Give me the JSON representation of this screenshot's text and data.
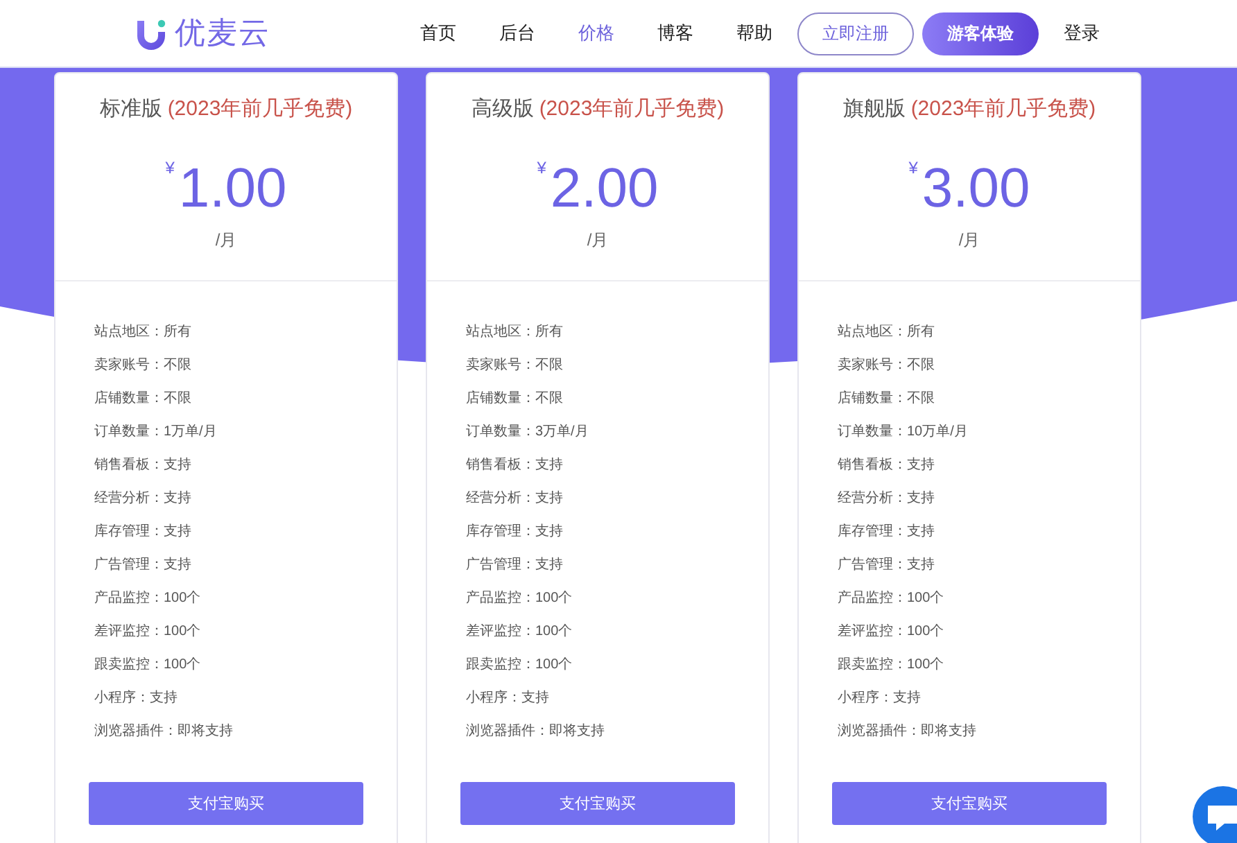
{
  "header": {
    "logo": "优麦云",
    "nav": [
      {
        "label": "首页",
        "selected": false
      },
      {
        "label": "后台",
        "selected": false
      },
      {
        "label": "价格",
        "selected": true
      },
      {
        "label": "博客",
        "selected": false
      },
      {
        "label": "帮助",
        "selected": false
      }
    ],
    "buttons": [
      {
        "label": "立即注册",
        "kind": "outline"
      },
      {
        "label": "游客体验",
        "kind": "filled"
      }
    ],
    "login": "登录"
  },
  "plans": [
    {
      "name": "标准版",
      "note": "(2023年前几乎免费)",
      "currency": "¥",
      "price": "1.00",
      "period": "/月",
      "features": [
        "站点地区：所有",
        "卖家账号：不限",
        "店铺数量：不限",
        "订单数量：1万单/月",
        "销售看板：支持",
        "经营分析：支持",
        "库存管理：支持",
        "广告管理：支持",
        "产品监控：100个",
        "差评监控：100个",
        "跟卖监控：100个",
        "小程序：支持",
        "浏览器插件：即将支持"
      ],
      "button": "支付宝购买"
    },
    {
      "name": "高级版",
      "note": "(2023年前几乎免费)",
      "currency": "¥",
      "price": "2.00",
      "period": "/月",
      "features": [
        "站点地区：所有",
        "卖家账号：不限",
        "店铺数量：不限",
        "订单数量：3万单/月",
        "销售看板：支持",
        "经营分析：支持",
        "库存管理：支持",
        "广告管理：支持",
        "产品监控：100个",
        "差评监控：100个",
        "跟卖监控：100个",
        "小程序：支持",
        "浏览器插件：即将支持"
      ],
      "button": "支付宝购买"
    },
    {
      "name": "旗舰版",
      "note": "(2023年前几乎免费)",
      "currency": "¥",
      "price": "3.00",
      "period": "/月",
      "features": [
        "站点地区：所有",
        "卖家账号：不限",
        "店铺数量：不限",
        "订单数量：10万单/月",
        "销售看板：支持",
        "经营分析：支持",
        "库存管理：支持",
        "广告管理：支持",
        "产品监控：100个",
        "差评监控：100个",
        "跟卖监控：100个",
        "小程序：支持",
        "浏览器插件：即将支持"
      ],
      "button": "支付宝购买"
    }
  ]
}
